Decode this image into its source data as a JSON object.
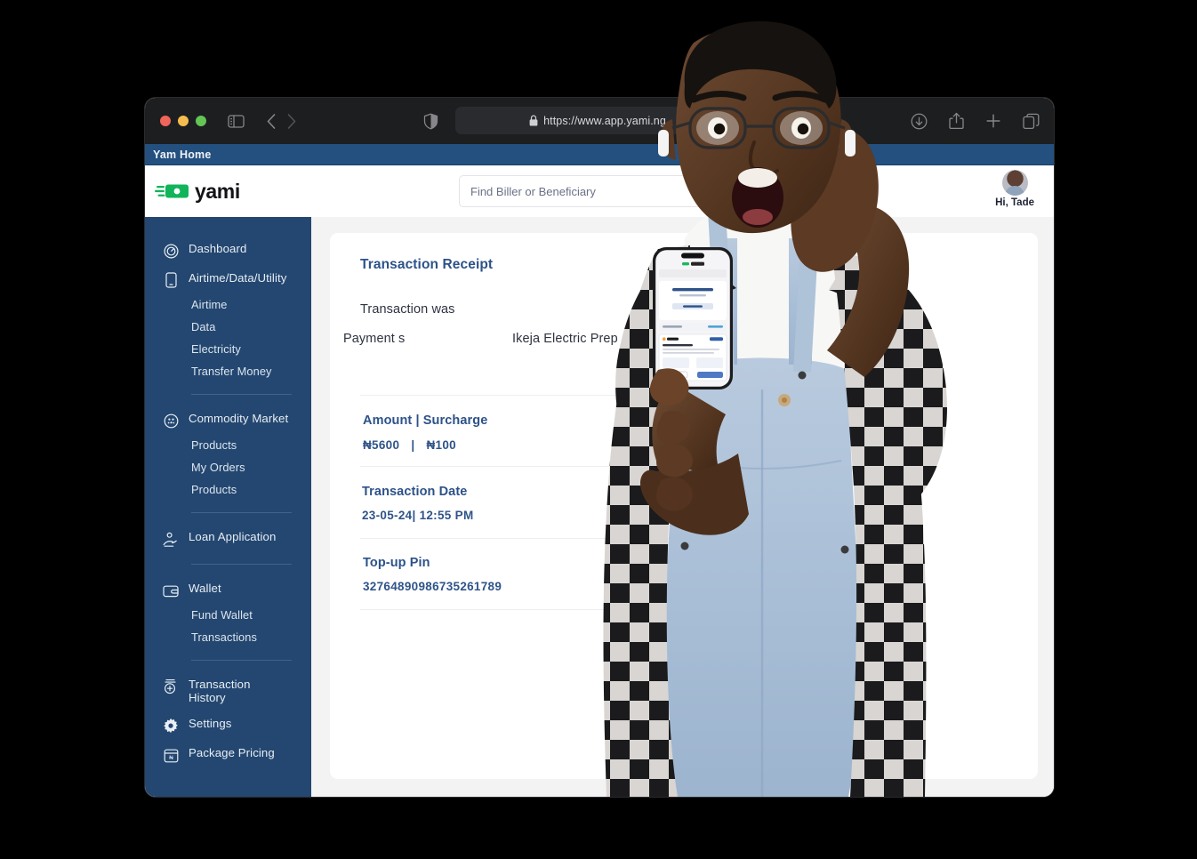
{
  "browser": {
    "url": "https://www.app.yami.ng",
    "lock_icon": "lock-icon",
    "reload_icon": "reload-icon",
    "shield_icon": "shield-icon",
    "sidebar_toggle_icon": "sidebar-toggle-icon",
    "back_icon": "chevron-left-icon",
    "forward_icon": "chevron-right-icon",
    "downloads_icon": "download-icon",
    "share_icon": "share-icon",
    "new_tab_icon": "plus-icon",
    "tabs_overview_icon": "tabs-overview-icon",
    "tab_title": "Yam Home",
    "traffic_lights": [
      "close",
      "minimize",
      "maximize"
    ]
  },
  "header": {
    "brand_name": "yami",
    "logo_icon": "yami-speed-money-logo",
    "search": {
      "placeholder": "Find Biller or Beneficiary",
      "value": ""
    },
    "user": {
      "greeting": "Hi, Tade",
      "avatar_icon": "user-avatar"
    }
  },
  "sidebar": {
    "groups": [
      {
        "items": [
          {
            "label": "Dashboard",
            "icon": "speedometer-icon",
            "type": "main"
          }
        ]
      },
      {
        "items": [
          {
            "label": "Airtime/Data/Utility",
            "icon": "mobile-phone-icon",
            "type": "main"
          },
          {
            "label": "Airtime",
            "icon": "",
            "type": "sub"
          },
          {
            "label": "Data",
            "icon": "",
            "type": "sub"
          },
          {
            "label": "Electricity",
            "icon": "",
            "type": "sub"
          },
          {
            "label": "Transfer Money",
            "icon": "",
            "type": "sub"
          }
        ]
      },
      {
        "items": [
          {
            "label": "Commodity Market",
            "icon": "commodity-grain-icon",
            "type": "main"
          },
          {
            "label": "Products",
            "icon": "",
            "type": "sub"
          },
          {
            "label": "My Orders",
            "icon": "",
            "type": "sub"
          },
          {
            "label": "Products",
            "icon": "",
            "type": "sub"
          }
        ]
      },
      {
        "items": [
          {
            "label": "Loan Application",
            "icon": "hand-money-icon",
            "type": "main"
          }
        ]
      },
      {
        "items": [
          {
            "label": "Wallet",
            "icon": "wallet-icon",
            "type": "main"
          },
          {
            "label": "Fund Wallet",
            "icon": "",
            "type": "sub"
          },
          {
            "label": "Transactions",
            "icon": "",
            "type": "sub"
          }
        ]
      },
      {
        "items": [
          {
            "label": "Transaction History",
            "icon": "transaction-history-icon",
            "type": "main"
          },
          {
            "label": "Settings",
            "icon": "gear-icon",
            "type": "main"
          },
          {
            "label": "Package Pricing",
            "icon": "calendar-pricing-icon",
            "type": "main"
          }
        ]
      }
    ]
  },
  "receipt": {
    "title": "Transaction Receipt",
    "status_top": "Transaction was",
    "status_bottom_left": "Payment s",
    "status_bottom_right": "Ikeja Electric Prep",
    "amount": {
      "label": "Amount | Surcharge",
      "value": "₦5600",
      "separator": "|",
      "surcharge": "₦100"
    },
    "date": {
      "label": "Transaction Date",
      "value": "23-05-24| 12:55 PM"
    },
    "pin": {
      "label": "Top-up Pin",
      "value": "32764890986735261789"
    }
  },
  "colors": {
    "sidebar_bg": "#234770",
    "tab_strip_bg": "#23507f",
    "toolbar_bg": "#1d1e20",
    "page_bg": "#f3f3f4",
    "card_bg": "#ffffff",
    "accent_blue": "#2d5289",
    "brand_green": "#11b45a",
    "text_dark": "#2e3340"
  }
}
